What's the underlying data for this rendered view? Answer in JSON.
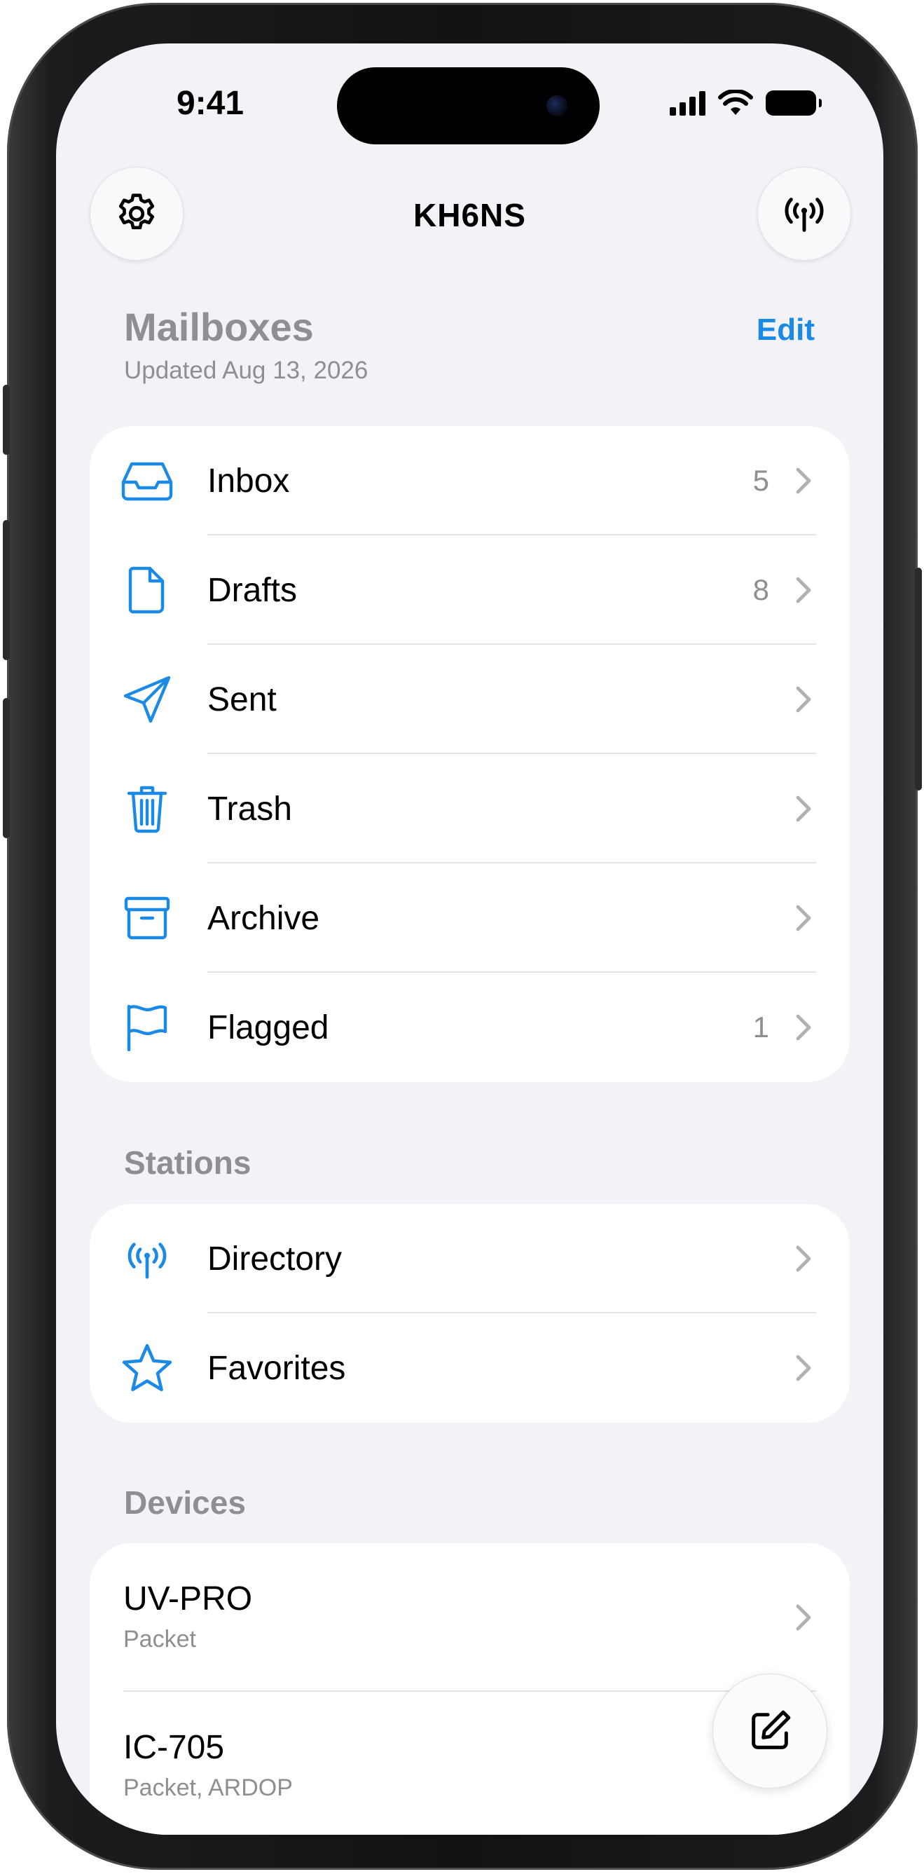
{
  "status_bar": {
    "time": "9:41"
  },
  "nav": {
    "title": "KH6NS"
  },
  "header": {
    "title": "Mailboxes",
    "subtitle": "Updated Aug 13, 2026",
    "edit_label": "Edit"
  },
  "mailboxes": [
    {
      "label": "Inbox",
      "count": "5",
      "icon": "tray-icon"
    },
    {
      "label": "Drafts",
      "count": "8",
      "icon": "document-icon"
    },
    {
      "label": "Sent",
      "count": "",
      "icon": "paperplane-icon"
    },
    {
      "label": "Trash",
      "count": "",
      "icon": "trash-icon"
    },
    {
      "label": "Archive",
      "count": "",
      "icon": "archive-box-icon"
    },
    {
      "label": "Flagged",
      "count": "1",
      "icon": "flag-icon"
    }
  ],
  "stations": {
    "title": "Stations",
    "items": [
      {
        "label": "Directory",
        "icon": "antenna-icon"
      },
      {
        "label": "Favorites",
        "icon": "star-icon"
      }
    ]
  },
  "devices": {
    "title": "Devices",
    "items": [
      {
        "name": "UV-PRO",
        "modes": "Packet"
      },
      {
        "name": "IC-705",
        "modes": "Packet, ARDOP"
      }
    ]
  },
  "colors": {
    "accent": "#1a8ae6",
    "secondary_text": "#8e8e93",
    "background": "#f2f2f7"
  }
}
